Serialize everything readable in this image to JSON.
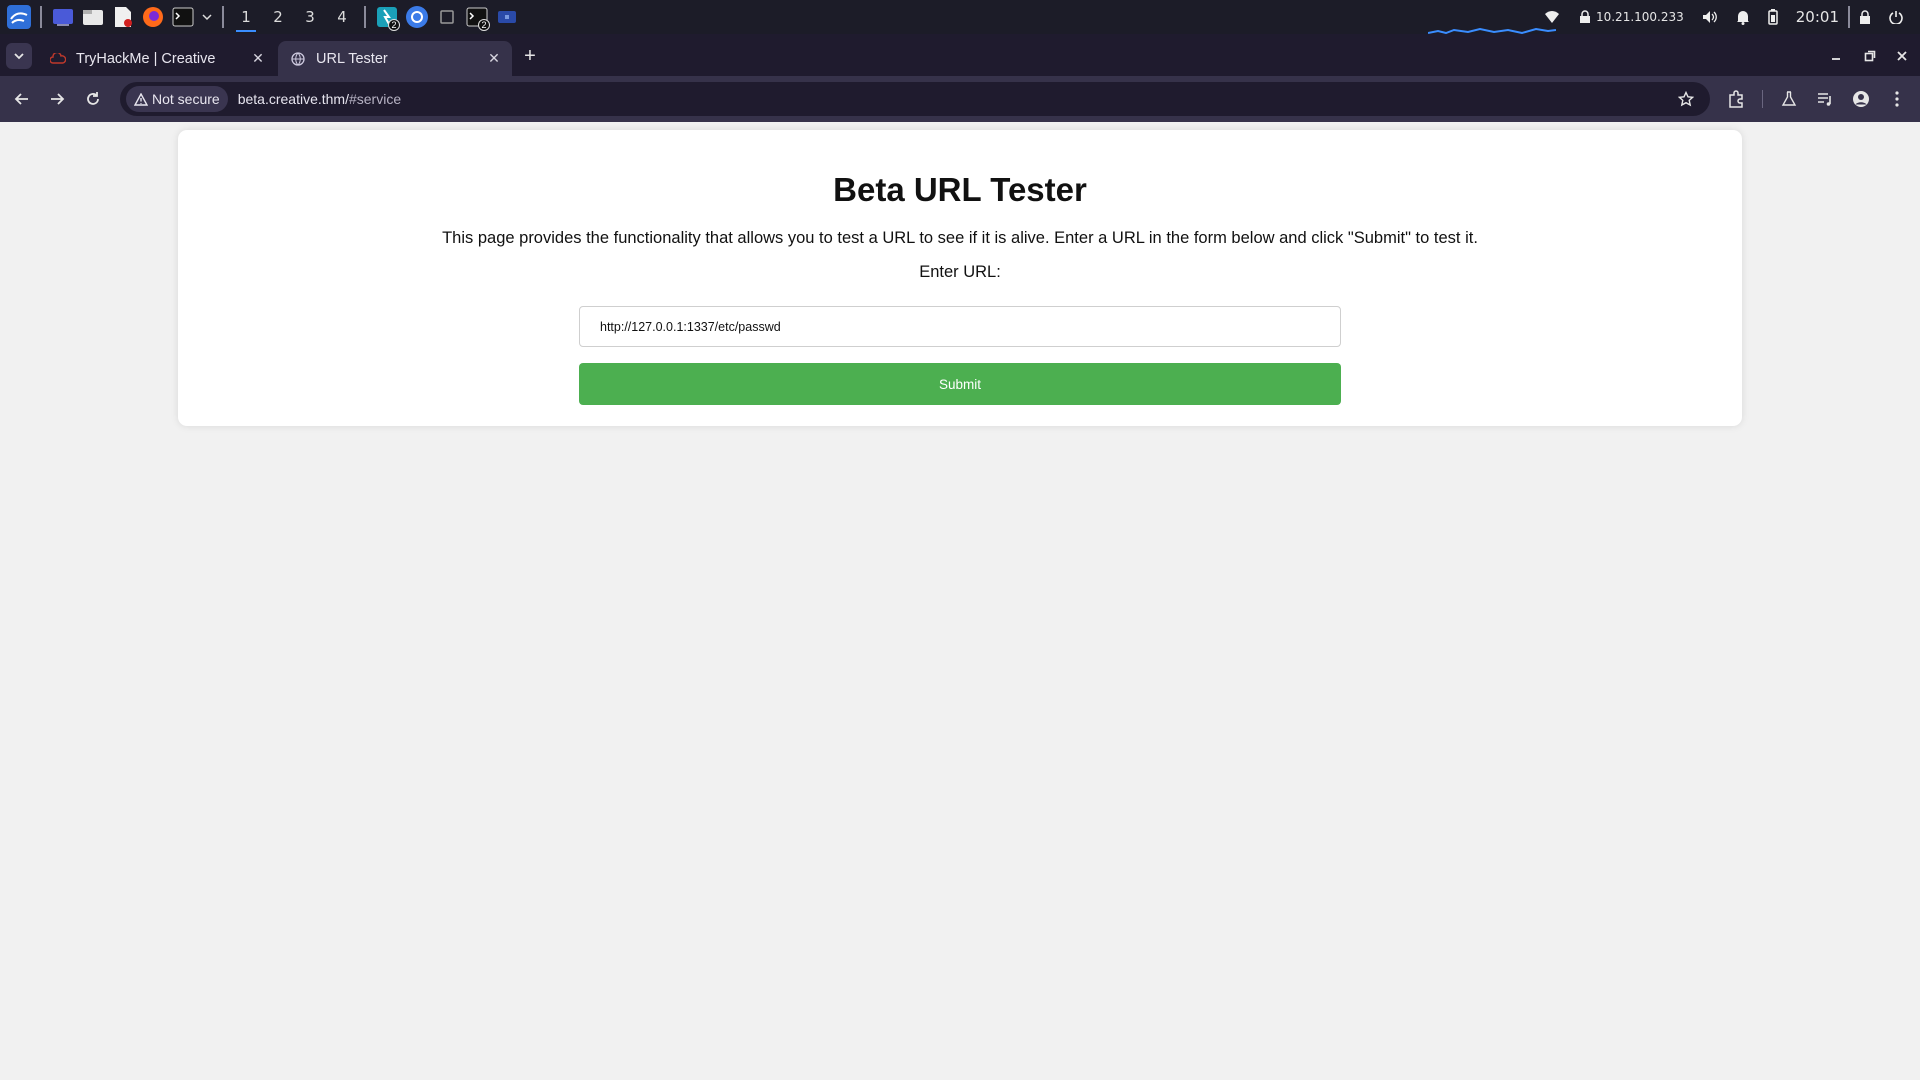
{
  "taskbar": {
    "workspaces": [
      "1",
      "2",
      "3",
      "4"
    ],
    "active_workspace": "1",
    "badge_count_a": "2",
    "badge_count_b": "2",
    "ip_address": "10.21.100.233",
    "clock": "20:01",
    "icons": [
      "kali-menu-icon",
      "desktop-icon",
      "file-manager-icon",
      "text-editor-icon",
      "firefox-icon",
      "terminal-icon",
      "chevron-down-icon",
      "burp-icon",
      "chromium-icon",
      "app-window-icon",
      "terminal-window-icon",
      "minimized-window-icon",
      "wifi-icon",
      "vpn-icon",
      "volume-icon",
      "bell-icon",
      "battery-icon",
      "lock-icon",
      "power-icon"
    ]
  },
  "browser": {
    "tabs": [
      {
        "title": "TryHackMe | Creative",
        "active": false
      },
      {
        "title": "URL Tester",
        "active": true
      }
    ],
    "security_label": "Not secure",
    "url_host": "beta.creative.thm/",
    "url_path": "#service",
    "accent": "#36324a"
  },
  "page": {
    "title": "Beta URL Tester",
    "description": "This page provides the functionality that allows you to test a URL to see if it is alive. Enter a URL in the form below and click \"Submit\" to test it.",
    "input_label": "Enter URL:",
    "url_value": "http://127.0.0.1:1337/etc/passwd",
    "submit_label": "Submit",
    "submit_color": "#4caf50"
  }
}
